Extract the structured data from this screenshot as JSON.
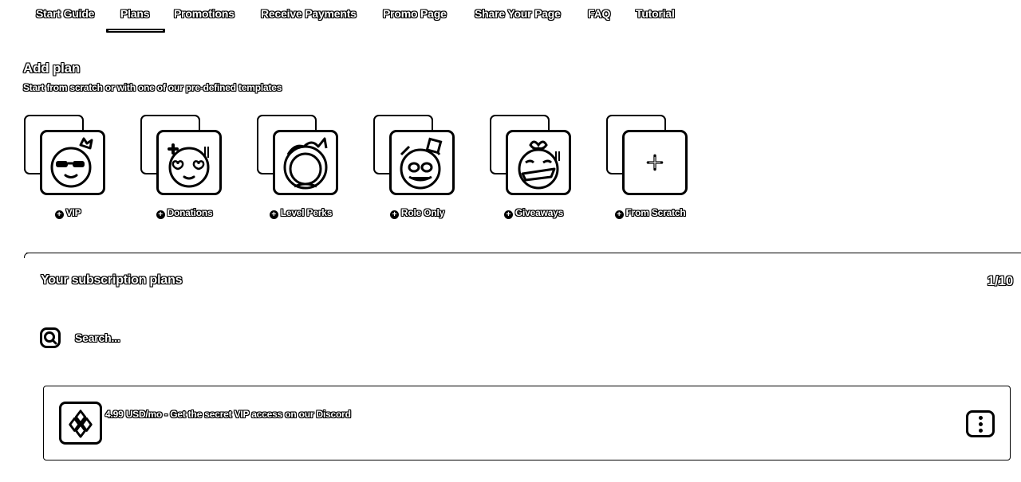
{
  "tabs": [
    {
      "label": "Start Guide",
      "active": false
    },
    {
      "label": "Plans",
      "active": true
    },
    {
      "label": "Promotions",
      "active": false
    },
    {
      "label": "Receive Payments",
      "active": false
    },
    {
      "label": "Promo Page",
      "active": false
    },
    {
      "label": "Share Your Page",
      "active": false
    },
    {
      "label": "FAQ",
      "active": false
    },
    {
      "label": "Tutorial",
      "active": false
    }
  ],
  "add_plan": {
    "title": "Add plan",
    "subtitle": "Start from scratch or with one of our pre-defined templates",
    "templates": [
      {
        "label": "VIP",
        "icon": "sunglasses-character-icon"
      },
      {
        "label": "Donations",
        "icon": "heart-eyes-character-icon"
      },
      {
        "label": "Level Perks",
        "icon": "crowned-character-icon"
      },
      {
        "label": "Role Only",
        "icon": "hat-character-icon"
      },
      {
        "label": "Giveaways",
        "icon": "gift-character-icon"
      },
      {
        "label": "From Scratch",
        "icon": "plus-icon"
      }
    ]
  },
  "subscriptions": {
    "title": "Your subscription plans",
    "count": "1/10",
    "search_placeholder": "Search...",
    "plans": [
      {
        "text": "4.99 USD/mo - Get the secret VIP access on our Discord",
        "icon": "sparkle-diamond-icon"
      }
    ]
  },
  "colors": {
    "background": "#ffffff",
    "foreground": "#000000"
  }
}
